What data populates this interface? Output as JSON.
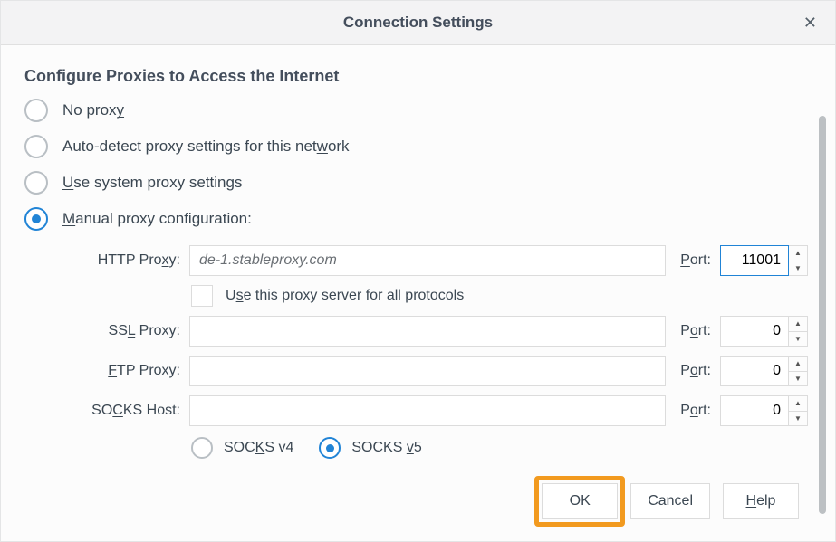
{
  "window": {
    "title": "Connection Settings"
  },
  "section": {
    "heading": "Configure Proxies to Access the Internet"
  },
  "proxyModes": {
    "noProxy_pre": "No prox",
    "noProxy_u": "y",
    "noProxy_post": "",
    "autoDetect_pre": "Auto-detect proxy settings for this net",
    "autoDetect_u": "w",
    "autoDetect_post": "ork",
    "system_pre": "",
    "system_u": "U",
    "system_post": "se system proxy settings",
    "manual_pre": "",
    "manual_u": "M",
    "manual_post": "anual proxy configuration:"
  },
  "labels": {
    "httpProxy_pre": "HTTP Pro",
    "httpProxy_u": "x",
    "httpProxy_post": "y:",
    "sslProxy_pre": "SS",
    "sslProxy_u": "L",
    "sslProxy_post": " Proxy:",
    "ftpProxy_pre": "",
    "ftpProxy_u": "F",
    "ftpProxy_post": "TP Proxy:",
    "socksHost_pre": "SO",
    "socksHost_u": "C",
    "socksHost_post": "KS Host:",
    "port_pre": "",
    "port_u": "P",
    "port_post": "ort:",
    "port2_pre": "P",
    "port2_u": "o",
    "port2_post": "rt:",
    "useAll_pre": "U",
    "useAll_u": "s",
    "useAll_post": "e this proxy server for all protocols",
    "socks4_pre": "SOC",
    "socks4_u": "K",
    "socks4_post": "S v4",
    "socks5_pre": "SOCKS ",
    "socks5_u": "v",
    "socks5_post": "5"
  },
  "values": {
    "httpHost": "de-1.stableproxy.com",
    "httpPort": "11001",
    "sslHost": "",
    "sslPort": "0",
    "ftpHost": "",
    "ftpPort": "0",
    "socksHost": "",
    "socksPort": "0"
  },
  "buttons": {
    "ok": "OK",
    "cancel": "Cancel",
    "help_pre": "",
    "help_u": "H",
    "help_post": "elp"
  }
}
